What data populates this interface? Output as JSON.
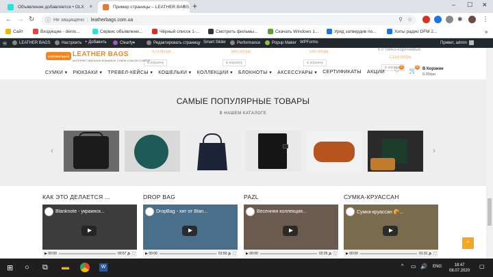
{
  "browser": {
    "tabs": [
      {
        "title": "Объявление добавляется • OLX",
        "favicon_color": "#23e5db",
        "active": false
      },
      {
        "title": "Пример страницы – LEATHER BAGS",
        "favicon_color": "#e07b39",
        "active": true
      }
    ],
    "new_tab_symbol": "+",
    "address": {
      "security_text": "Не защищено",
      "url": "leatherbags.com.ua"
    },
    "bookmarks": [
      {
        "label": "Сайт",
        "color": "#f4b400"
      },
      {
        "label": "Входящие - denis...",
        "color": "#ea4335"
      },
      {
        "label": "Сервис объявлени...",
        "color": "#23e5db"
      },
      {
        "label": "Чёрный список 1-...",
        "color": "#d93025"
      },
      {
        "label": "Смотреть фильмы...",
        "color": "#333333"
      },
      {
        "label": "Скачать Windows 1...",
        "color": "#5aa02c"
      },
      {
        "label": "Уряд затвердив по...",
        "color": "#1a73e8"
      },
      {
        "label": "Хиты радио DFM 2...",
        "color": "#1a73e8"
      }
    ]
  },
  "wp_admin": {
    "items": [
      "LEATHER BAGS",
      "Настроить",
      "+ Добавить",
      "Clearfy",
      "Редактировать страницу",
      "Smart Slider",
      "Performance",
      "Popup Maker",
      "WPForms"
    ],
    "greeting": "Привет, admin"
  },
  "site": {
    "logo_badge": "LEATHER BAGS",
    "logo_title": "LEATHER BAGS",
    "logo_tagline": "ИНТЕРНЕТ-МАГАЗИН КОЖАНЫХ СУМОК И АКСЕССУАРОВ",
    "ghost_prices": [
      "970.00грн.",
      "840.00грн.",
      "240.00грн.",
      "1,150.00грн."
    ],
    "ghost_button": "в корзину",
    "ghost_product_name": "6.0 темно-коричневый",
    "nav": [
      "СУМКИ",
      "РЮКЗАКИ",
      "ТРЕВЕЛ-КЕЙСЫ",
      "КОШЕЛЬКИ",
      "КОЛЛЕКЦИИ",
      "БЛОКНОТЫ",
      "АКСЕССУАРЫ",
      "СЕРТИФИКАТЫ",
      "АКЦИИ"
    ],
    "nav_has_dropdown": [
      true,
      true,
      true,
      true,
      true,
      true,
      true,
      false,
      false
    ],
    "wishlist_count": "0",
    "cart_count": "0",
    "cart_label": "В Корзине",
    "cart_sum": "0.00грн."
  },
  "popular": {
    "title": "САМЫЕ ПОПУЛЯРНЫЕ ТОВАРЫ",
    "subtitle": "В НАШЕМ КАТАЛОГЕ",
    "products": [
      {
        "name": "black-backpack",
        "color": "#1b1b1b",
        "bg": "#6a6a6a"
      },
      {
        "name": "teal-round-bag",
        "color": "#1e5a58",
        "bg": "#d9d9d9"
      },
      {
        "name": "navy-tote",
        "color": "#1d2438",
        "bg": "#ececec"
      },
      {
        "name": "black-notebook",
        "color": "#161616",
        "bg": "#e8e8e8"
      },
      {
        "name": "tan-belt-bag",
        "color": "#b5541f",
        "bg": "#f2f2f2"
      },
      {
        "name": "green-crossbody",
        "color": "#1d3d2c",
        "bg": "#2a2a2a"
      }
    ],
    "prev_arrow": "‹",
    "next_arrow": "›"
  },
  "videos": [
    {
      "section_title": "КАК ЭТО ДЕЛАЕТСЯ ...",
      "video_title": "Blanknote - украинск...",
      "elapsed": "00:00",
      "duration": "00:57",
      "bg": "#3c3c3c"
    },
    {
      "section_title": "DROP BAG",
      "video_title": "DropBag - хит от Blan...",
      "elapsed": "00:00",
      "duration": "01:50",
      "bg": "#4a6f8a"
    },
    {
      "section_title": "PAZL",
      "video_title": "Весенняя коллекция...",
      "elapsed": "00:00",
      "duration": "02:25",
      "bg": "#6b5a4e"
    },
    {
      "section_title": "СУМКА-КРУАССАН",
      "video_title": "Сумка-круассан 🥐...",
      "elapsed": "00:00",
      "duration": "01:31",
      "bg": "#7a6a4e"
    }
  ],
  "back_to_top": "^",
  "taskbar": {
    "language": "ENG",
    "time": "18:47",
    "date": "08.07.2020"
  },
  "accent_color": "#f5851f"
}
